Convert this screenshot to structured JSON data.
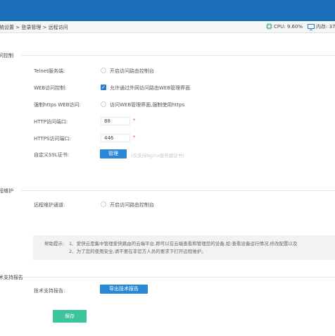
{
  "header": {
    "breadcrumb": "统设置 > 登录管理 > 远程访问",
    "cpu": "CPU: 9.60%",
    "memory": "内存: 37"
  },
  "sections": {
    "remote_control": "问控制",
    "remote_maintenance": "程维护",
    "tech_support": "术支持报告"
  },
  "remote_control": {
    "telnet_label": "Telnet服务端:",
    "telnet_option": "开启访问路由控制台",
    "web_label": "WEB访问控制:",
    "web_option": "允许通过外网访问路由WEB管理界面",
    "web_checked": true,
    "https_label": "强制https WEB访问:",
    "https_option": "访问WEB管理界面,强制使用https",
    "http_port_label": "HTTP访问端口:",
    "http_port": "88",
    "https_port_label": "HTTPS访问端口:",
    "https_port": "446",
    "required_mark": "*",
    "ssl_label": "自定义SSL证书:",
    "ssl_button": "管理",
    "ssl_hint": "(仅支持Nginx服务器证书)"
  },
  "remote_maintenance": {
    "channel_label": "远程维护通道:",
    "channel_option": "开启访问路由控制台"
  },
  "help": {
    "label": "帮助提示:",
    "line1": "1、爱快云是集中管理爱快路由的云端平台,即可以在云端查看和管理您的设备,如:查看设备运行情况,修改配置以及",
    "line2": "2、为了您的使用安全,请不要在非官方人员的要求下打开远程维护。"
  },
  "tech_support": {
    "report_label": "技术支持报告:",
    "export_button": "导出技术报告"
  },
  "footer": {
    "save_button": "保存"
  },
  "colors": {
    "topbar": "#1b6fb8",
    "primary_button": "#2a87d6",
    "save_button": "#3cc59c",
    "required": "#e4393c"
  }
}
